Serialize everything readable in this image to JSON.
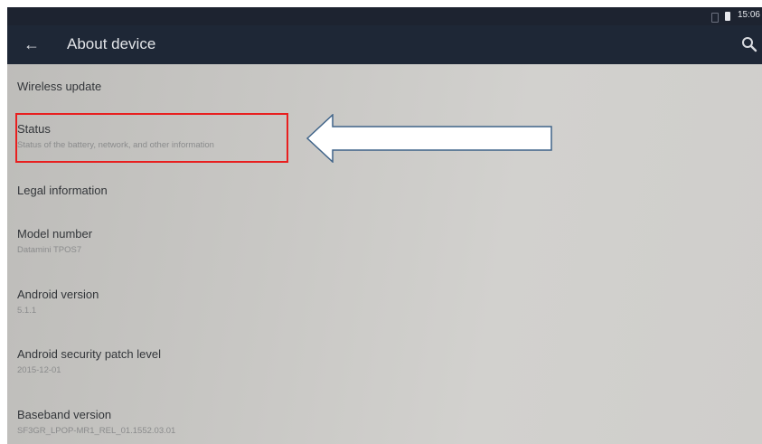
{
  "status_bar": {
    "time": "15:06",
    "icons": [
      "signal-icon",
      "battery-icon"
    ]
  },
  "app_bar": {
    "title": "About device",
    "back_icon": "arrow-back-icon",
    "search_icon": "search-icon"
  },
  "items": [
    {
      "title": "Wireless update"
    },
    {
      "title": "Status",
      "summary": "Status of the battery, network, and other information"
    },
    {
      "title": "Legal information"
    },
    {
      "title": "Model number",
      "summary": "Datamini TPOS7"
    },
    {
      "title": "Android version",
      "summary": "5.1.1"
    },
    {
      "title": "Android security patch level",
      "summary": "2015-12-01"
    },
    {
      "title": "Baseband version",
      "summary": "SF3GR_LPOP-MR1_REL_01.1552.03.01"
    }
  ],
  "annotation": {
    "highlight_color": "#e81f1f",
    "arrow_fill": "#ffffff",
    "arrow_stroke": "#3f6388"
  }
}
